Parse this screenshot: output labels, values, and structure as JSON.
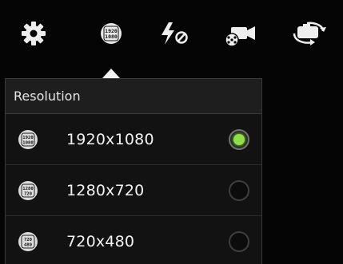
{
  "toolbar": {
    "items": [
      {
        "icon": "settings-gear-icon"
      },
      {
        "icon": "resolution-1920-1080-icon",
        "text_top": "1920",
        "text_bottom": "1080"
      },
      {
        "icon": "flash-off-icon"
      },
      {
        "icon": "video-camera-icon"
      },
      {
        "icon": "switch-camera-icon"
      }
    ]
  },
  "resolution_panel": {
    "title": "Resolution",
    "options": [
      {
        "label": "1920x1080",
        "icon_top": "1920",
        "icon_bottom": "1080",
        "selected": true
      },
      {
        "label": "1280x720",
        "icon_top": "1280",
        "icon_bottom": "720",
        "selected": false
      },
      {
        "label": "720x480",
        "icon_top": "720",
        "icon_bottom": "480",
        "selected": false
      }
    ]
  },
  "colors": {
    "background": "#050505",
    "panel": "#121212",
    "selected_radio": "#8ee045",
    "text": "#f2f2f2"
  }
}
